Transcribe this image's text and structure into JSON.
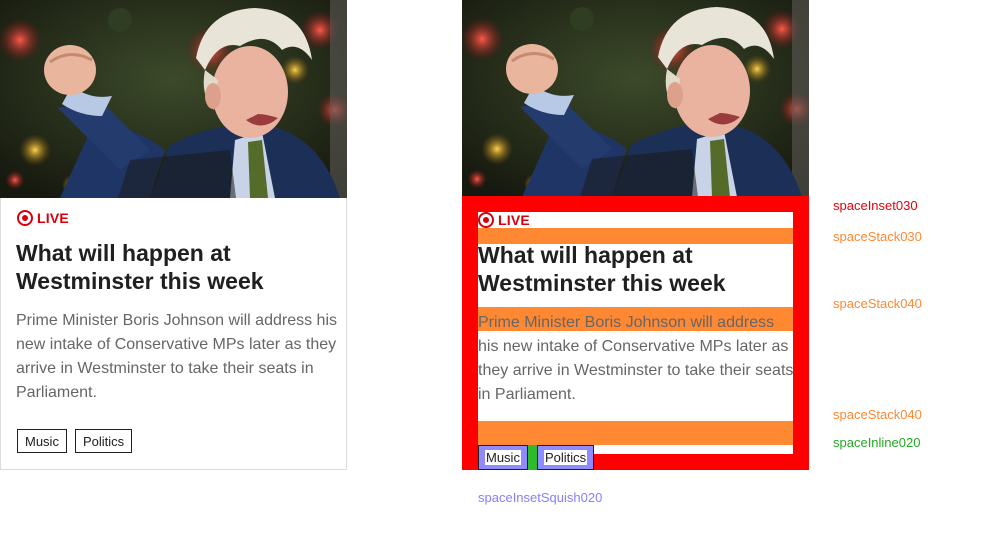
{
  "card": {
    "live_label": "LIVE",
    "headline": "What will happen at Westminster this week",
    "summary": "Prime Minister Boris Johnson will address his new intake of Conservative MPs later as they arrive in Westminster to take their seats in Parliament.",
    "tags": [
      "Music",
      "Politics"
    ]
  },
  "annotations": {
    "inset": "spaceInset030",
    "stack_live": "spaceStack030",
    "stack_headline": "spaceStack040",
    "stack_summary": "spaceStack040",
    "inline_tags": "spaceInline020",
    "inset_squish_tags": "spaceInsetSquish020"
  },
  "colors": {
    "live": "#d8000c",
    "inset": "#ff0000",
    "stack": "#ff8833",
    "inline": "#2dbb2d",
    "inset_squish": "#8f8bff"
  }
}
